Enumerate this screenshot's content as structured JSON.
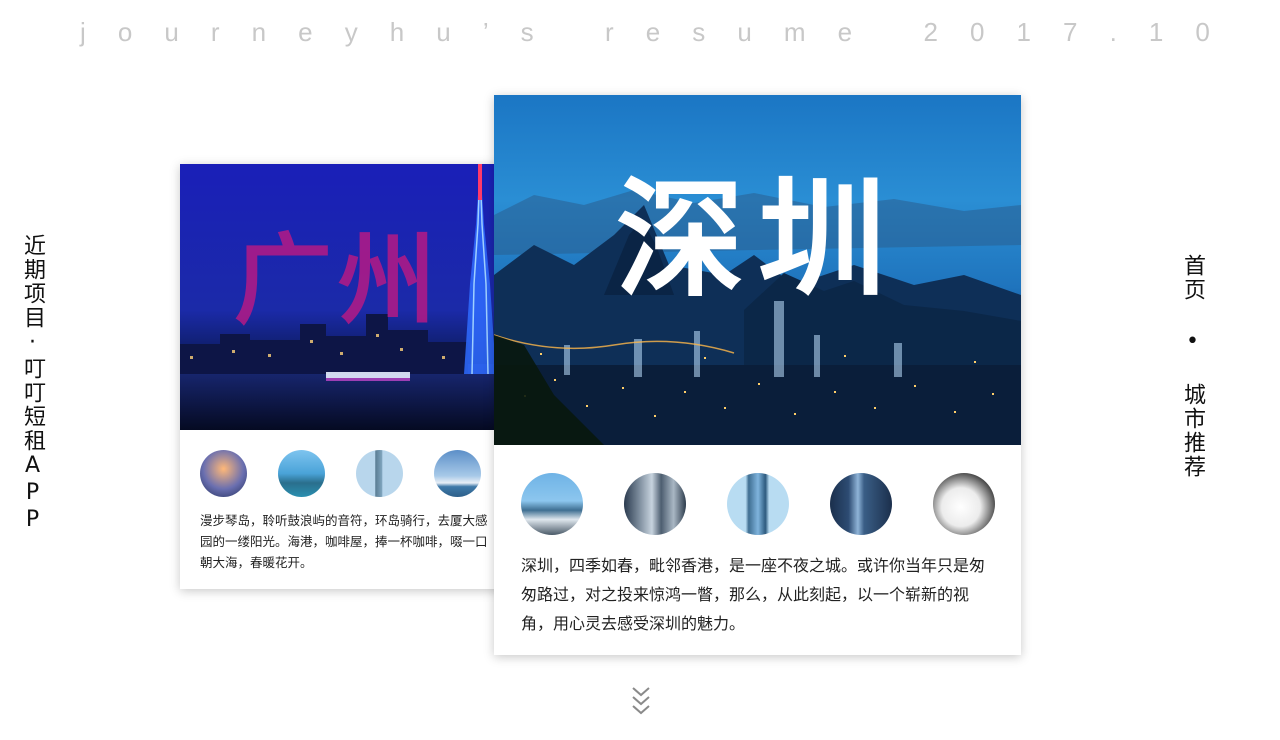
{
  "header": {
    "title_chars": [
      "j",
      "o",
      "u",
      "r",
      "n",
      "e",
      "y",
      "h",
      "u",
      "’",
      "s",
      " ",
      "r",
      "e",
      "s",
      "u",
      "m",
      "e",
      " ",
      "2",
      "0",
      "1",
      "7",
      ".",
      "1",
      "0"
    ]
  },
  "left_label": "近期项目·叮叮短租APP",
  "right_label": "首页 • 城市推荐",
  "cards": {
    "guangzhou": {
      "city": "广州",
      "description": "漫步琴岛，聆听鼓浪屿的音符，环岛骑行，去厦大感\n园的一缕阳光。海港，咖啡屋，捧一杯咖啡，啜一口\n朝大海，春暖花开。",
      "thumbnails": [
        "sunset-pier-photo",
        "skyline-bay-photo",
        "tower-photo",
        "sky-ship-photo"
      ]
    },
    "shenzhen": {
      "city": "深圳",
      "description": "深圳，四季如春，毗邻香港，是一座不夜之城。或许你当年只是匆匆路过，对之投来惊鸿一瞥，那么，从此刻起，以一个崭新的视角，用心灵去感受深圳的魅力。",
      "thumbnails": [
        "waterfront-skyline-photo",
        "towers-photo",
        "glass-tower-photo",
        "night-tower-photo",
        "white-building-photo"
      ]
    }
  },
  "colors": {
    "header_text": "#c8c8c8",
    "guangzhou_word": "#b41a86",
    "shenzhen_word": "#ffffff",
    "scroll_icon": "#8a8a8a"
  },
  "icons": {
    "scroll": "chevron-down-double-icon"
  }
}
